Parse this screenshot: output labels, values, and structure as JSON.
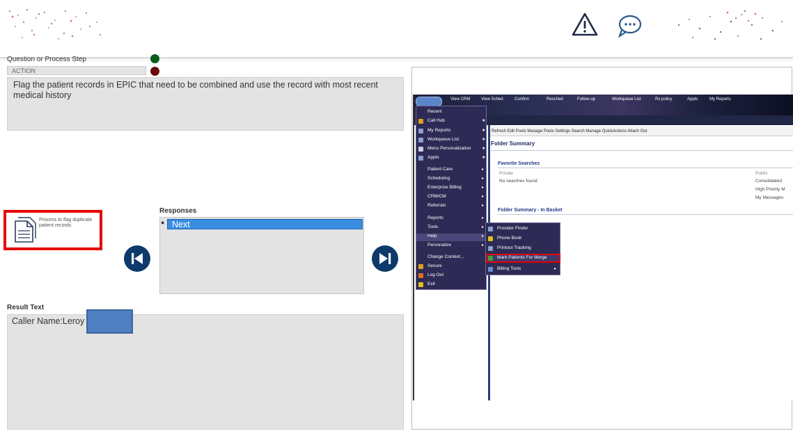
{
  "header": {
    "logo_left": "logo-left",
    "warning_icon": "warning-triangle-icon",
    "chat_icon": "chat-bubble-icon",
    "logo_right": "logo-right"
  },
  "step": {
    "label": "Question or Process Step",
    "action_label": "ACTION",
    "action_text": "Flag the patient records in EPIC that need to be combined and use the record with most recent medical history"
  },
  "document": {
    "text": "Process to flag duplicate patient records"
  },
  "responses": {
    "label": "Responses",
    "selected": "Next"
  },
  "result": {
    "label": "Result Text",
    "text": "Caller Name:Leroy"
  },
  "epic": {
    "toolbar_items": [
      "View CRM",
      "View Sched",
      "Confirm",
      "Resched",
      "Follow-up",
      "Workqueue List",
      "Rx policy",
      "Appts",
      "My Reports"
    ],
    "sub_toolbar": "Refresh  Edit Pools  Manage Pools  Settings  Search  Manage QuickActions  Attach  Out",
    "folder_summary": "Folder Summary",
    "favorite_searches": "Favorite Searches",
    "private_label": "Private",
    "public_label": "Public",
    "no_searches": "No searches found",
    "public_items": [
      "Consolidated",
      "High Priority M",
      "My Messages"
    ],
    "inbasket_label": "Folder Summary - In Basket",
    "menu_items": [
      {
        "label": "Recent",
        "type": "plain"
      },
      {
        "label": "Call Hub",
        "type": "star"
      },
      {
        "label": "My Reports",
        "type": "star"
      },
      {
        "label": "Workqueue List",
        "type": "star"
      },
      {
        "label": "Menu Personalization",
        "type": "star"
      },
      {
        "label": "Appts",
        "type": "star"
      },
      {
        "label": "Patient Care",
        "type": "arrow"
      },
      {
        "label": "Scheduling",
        "type": "arrow"
      },
      {
        "label": "Enterprise Billing",
        "type": "arrow"
      },
      {
        "label": "CRM/CM",
        "type": "arrow"
      },
      {
        "label": "Referrals",
        "type": "arrow"
      },
      {
        "label": "Reports",
        "type": "arrow"
      },
      {
        "label": "Tools",
        "type": "arrow"
      },
      {
        "label": "Help",
        "type": "arrow"
      },
      {
        "label": "Personalize",
        "type": "arrow"
      },
      {
        "label": "Change Context...",
        "type": "plain"
      },
      {
        "label": "Secure",
        "type": "plain"
      },
      {
        "label": "Log Out",
        "type": "plain"
      },
      {
        "label": "Exit",
        "type": "plain"
      }
    ],
    "submenu_items": [
      "Provider Finder",
      "Phone Book",
      "Printout Tracking",
      "Mark Patients For Merge",
      "Billing Tools"
    ]
  }
}
